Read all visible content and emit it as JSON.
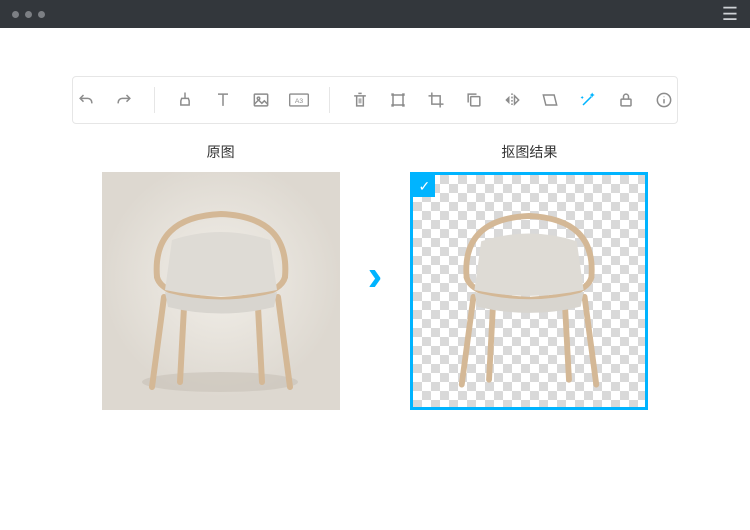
{
  "labels": {
    "original": "原图",
    "result": "抠图结果"
  },
  "colors": {
    "accent": "#00b4ff",
    "toolbar_icon": "#8c8c8c",
    "titlebar": "#33373c"
  },
  "toolbar": {
    "icons": [
      {
        "name": "undo",
        "active": false
      },
      {
        "name": "redo",
        "active": false
      },
      {
        "name": "brush",
        "active": false
      },
      {
        "name": "text",
        "active": false
      },
      {
        "name": "image",
        "active": false
      },
      {
        "name": "aspect-ratio",
        "active": false
      },
      {
        "name": "delete",
        "active": false
      },
      {
        "name": "transform",
        "active": false
      },
      {
        "name": "crop",
        "active": false
      },
      {
        "name": "copy",
        "active": false
      },
      {
        "name": "flip-horizontal",
        "active": false
      },
      {
        "name": "skew",
        "active": false
      },
      {
        "name": "magic-cutout",
        "active": true
      },
      {
        "name": "lock",
        "active": false
      },
      {
        "name": "info",
        "active": false
      }
    ]
  },
  "result": {
    "selected": true
  }
}
